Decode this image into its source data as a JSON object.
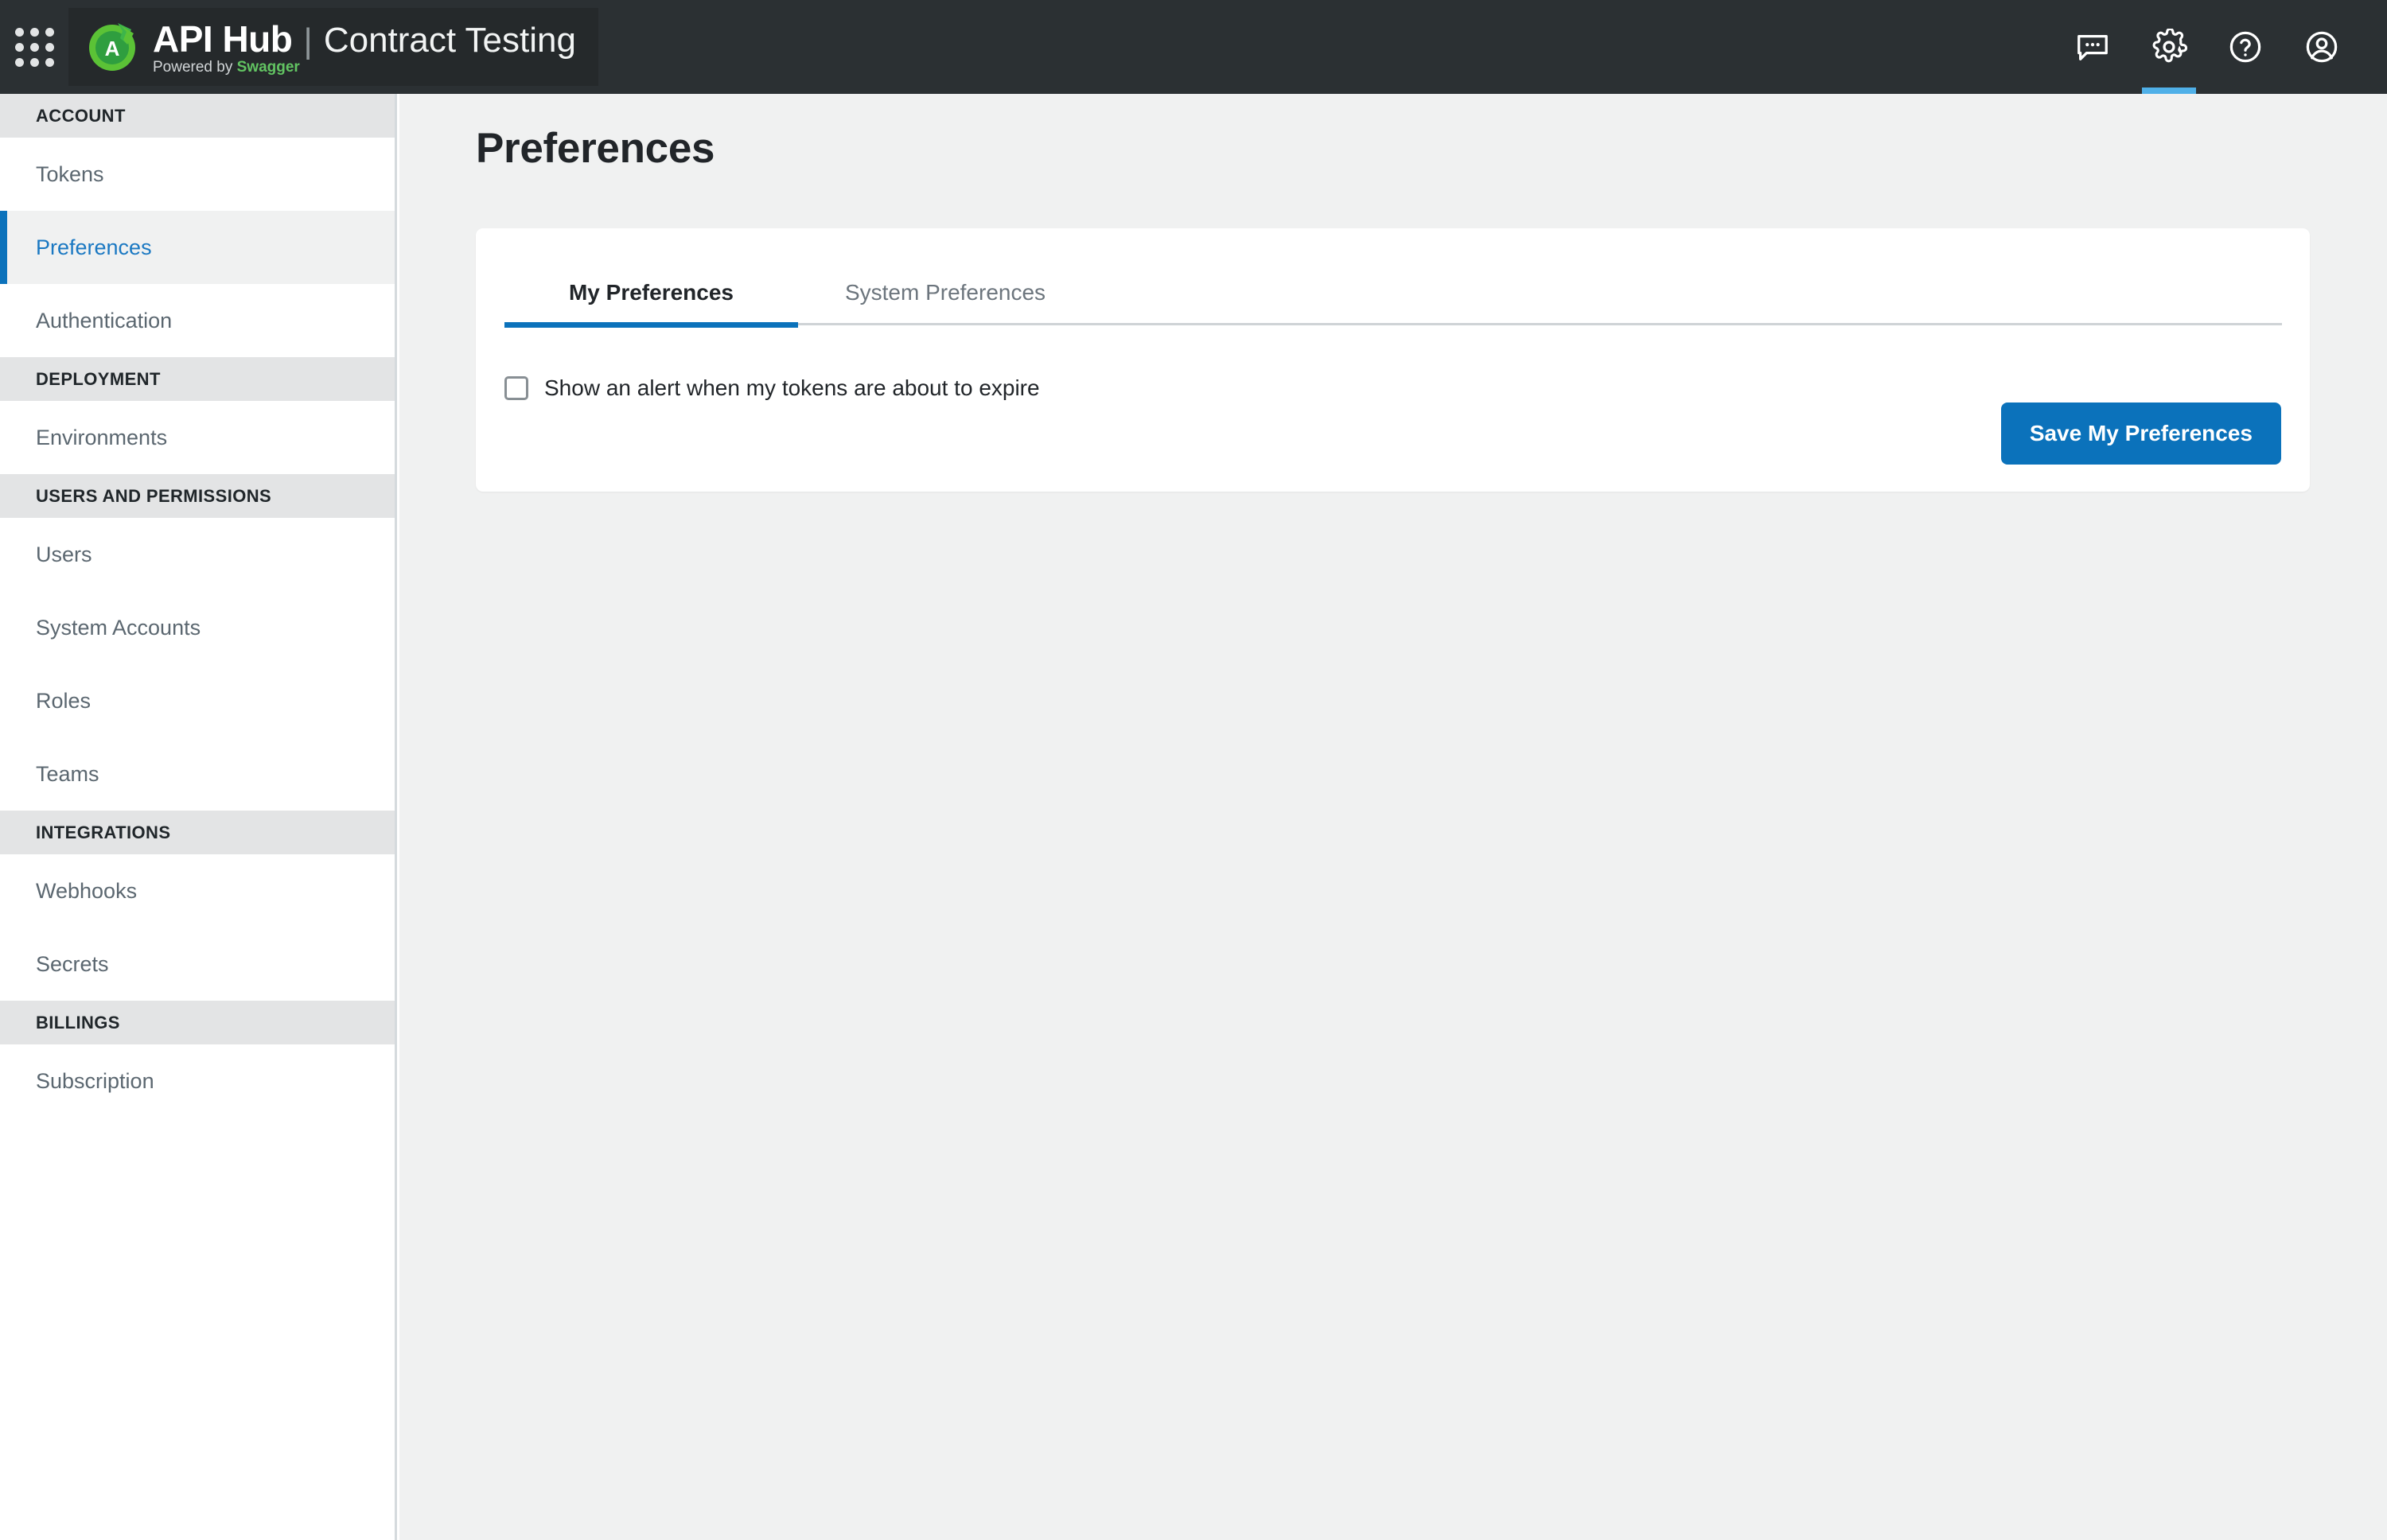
{
  "topbar": {
    "waffle_icon": "apps-grid-icon",
    "brand": {
      "product_name": "API Hub",
      "separator": "|",
      "product_suffix": "Contract Testing",
      "powered_prefix": "Powered by ",
      "powered_brand": "Swagger",
      "logo_letter": "A"
    },
    "actions": [
      {
        "name": "feedback-icon",
        "label": "Feedback",
        "active": false
      },
      {
        "name": "gear-icon",
        "label": "Settings",
        "active": true
      },
      {
        "name": "help-icon",
        "label": "Help",
        "active": false
      },
      {
        "name": "account-icon",
        "label": "Account",
        "active": false
      }
    ],
    "accent_color": "#4fb0e8",
    "background": "#2b3033"
  },
  "sidebar": {
    "groups": [
      {
        "title": "ACCOUNT",
        "items": [
          {
            "label": "Tokens",
            "active": false
          },
          {
            "label": "Preferences",
            "active": true
          },
          {
            "label": "Authentication",
            "active": false
          }
        ]
      },
      {
        "title": "DEPLOYMENT",
        "items": [
          {
            "label": "Environments",
            "active": false
          }
        ]
      },
      {
        "title": "USERS AND PERMISSIONS",
        "items": [
          {
            "label": "Users",
            "active": false
          },
          {
            "label": "System Accounts",
            "active": false
          },
          {
            "label": "Roles",
            "active": false
          },
          {
            "label": "Teams",
            "active": false
          }
        ]
      },
      {
        "title": "INTEGRATIONS",
        "items": [
          {
            "label": "Webhooks",
            "active": false
          },
          {
            "label": "Secrets",
            "active": false
          }
        ]
      },
      {
        "title": "BILLINGS",
        "items": [
          {
            "label": "Subscription",
            "active": false
          }
        ]
      }
    ],
    "active_color": "#1a78c2",
    "active_bar_color": "#0b72bb"
  },
  "main": {
    "page_title": "Preferences",
    "tabs": [
      {
        "label": "My Preferences",
        "active": true
      },
      {
        "label": "System Preferences",
        "active": false
      }
    ],
    "checkbox": {
      "label": "Show an alert when my tokens are about to expire",
      "checked": false
    },
    "save_button": {
      "label": "Save My Preferences",
      "color": "#0b72bb"
    }
  }
}
